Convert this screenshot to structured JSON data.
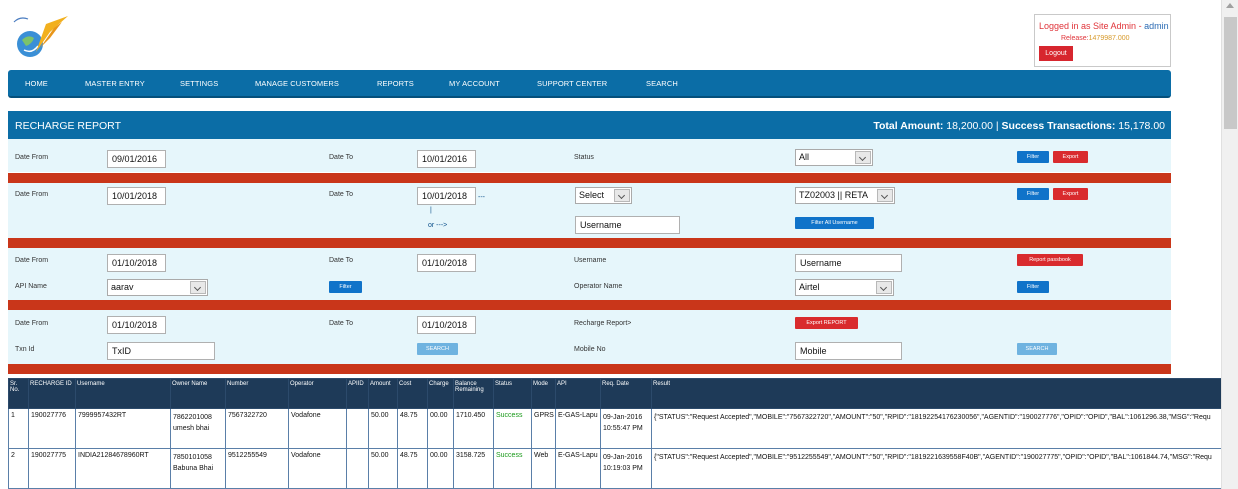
{
  "header": {
    "logged_in_text": "Logged in as Site Admin - ",
    "user": "admin",
    "release_label": "Release:",
    "release_value": "1479987.000",
    "logout_label": "Logout"
  },
  "nav": [
    "HOME",
    "MASTER ENTRY",
    "SETTINGS",
    "MANAGE CUSTOMERS",
    "REPORTS",
    "MY ACCOUNT",
    "SUPPORT CENTER",
    "SEARCH"
  ],
  "report": {
    "title": "RECHARGE REPORT",
    "total_amount_label": "Total Amount:",
    "total_amount_value": "18,200.00",
    "success_label": "Success Transactions:",
    "success_value": "15,178.00"
  },
  "filter1": {
    "date_from_label": "Date From",
    "date_from": "09/01/2016",
    "date_to_label": "Date To",
    "date_to": "10/01/2016",
    "status_label": "Status",
    "status_value": "All",
    "filter_btn": "Filter",
    "export_btn": "Export"
  },
  "filter2": {
    "date_from_label": "Date From",
    "date_from": "10/01/2018",
    "date_to_label": "Date To",
    "date_to": "10/01/2018",
    "arrow_right": "---",
    "pipe": "|",
    "or_arrow": "or --->",
    "select_value": "Select",
    "operator_value": "TZ02003 || RETA",
    "username_placeholder": "Username",
    "filter_btn": "Filter",
    "export_btn": "Export",
    "filter_all_btn": "Filter All Username"
  },
  "filter3": {
    "date_from_label": "Date From",
    "date_from": "01/10/2018",
    "date_to_label": "Date To",
    "date_to": "01/10/2018",
    "username_label": "Username",
    "username_placeholder": "Username",
    "report_btn": "Report passbook",
    "api_label": "API Name",
    "api_value": "aarav",
    "api_filter_btn": "Filter",
    "operator_label": "Operator Name",
    "operator_value": "Airtel",
    "operator_filter_btn": "Filter"
  },
  "filter4": {
    "date_from_label": "Date From",
    "date_from": "01/10/2018",
    "date_to_label": "Date To",
    "date_to": "01/10/2018",
    "recharge_label": "Recharge Report>",
    "export_report_btn": "Export REPORT",
    "txn_label": "Txn Id",
    "txn_placeholder": "TxID",
    "txn_search_btn": "SEARCH",
    "mobile_label": "Mobile No",
    "mobile_placeholder": "Mobile",
    "mobile_search_btn": "SEARCH"
  },
  "table": {
    "headers": [
      "Sr. No.",
      "RECHARGE ID",
      "Username",
      "Owner Name",
      "Number",
      "Operator",
      "APIID",
      "Amount",
      "Cost",
      "Charge",
      "Balance Remaining",
      "Status",
      "Mode",
      "API",
      "Req. Date",
      "Result"
    ],
    "rows": [
      {
        "sr": "1",
        "id": "190027776",
        "username": "7999957432RT",
        "owner": "7862201008 umesh bhai",
        "number": "7567322720",
        "operator": "Vodafone",
        "apiid": "",
        "amount": "50.00",
        "cost": "48.75",
        "charge": "00.00",
        "balance": "1710.450",
        "status": "Success",
        "mode": "GPRS",
        "api": "E-GAS-Lapu",
        "date": "09-Jan-2016 10:55:47 PM",
        "result": "{\"STATUS\":\"Request Accepted\",\"MOBILE\":\"7567322720\",\"AMOUNT\":\"50\",\"RPID\":\"18192254176230056\",\"AGENTID\":\"190027776\",\"OPID\":\"OPID\",\"BAL\":1061296.38,\"MSG\":\"Requ"
      },
      {
        "sr": "2",
        "id": "190027775",
        "username": "INDIA21284678960RT",
        "owner": "7850101058 Babuna Bhai",
        "number": "9512255549",
        "operator": "Vodafone",
        "apiid": "",
        "amount": "50.00",
        "cost": "48.75",
        "charge": "00.00",
        "balance": "3158.725",
        "status": "Success",
        "mode": "Web",
        "api": "E-GAS-Lapu",
        "date": "09-Jan-2016 10:19:03 PM",
        "result": "{\"STATUS\":\"Request Accepted\",\"MOBILE\":\"9512255549\",\"AMOUNT\":\"50\",\"RPID\":\"1819221639558F40B\",\"AGENTID\":\"190027775\",\"OPID\":\"OPID\",\"BAL\":1061844.74,\"MSG\":\"Requ"
      }
    ]
  }
}
